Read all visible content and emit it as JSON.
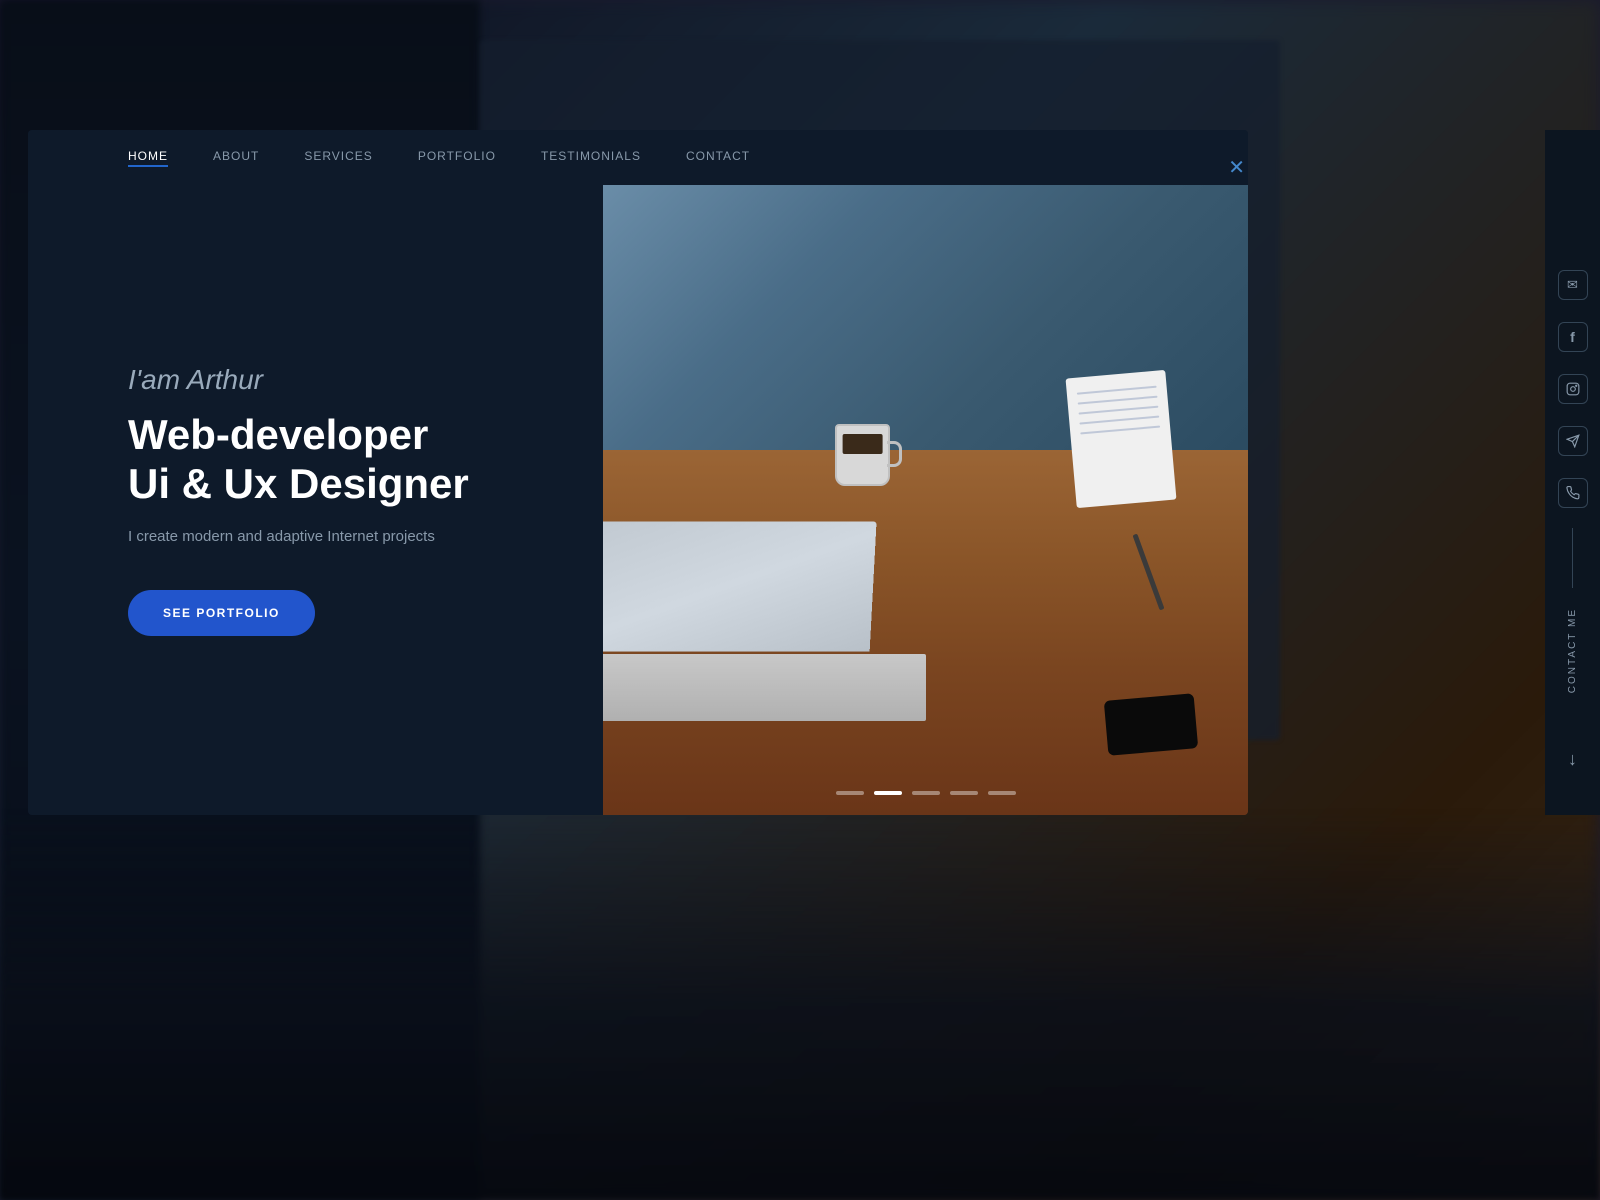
{
  "background": {
    "color": "#0a0e18"
  },
  "navbar": {
    "items": [
      {
        "label": "HOME",
        "active": true
      },
      {
        "label": "ABOUT",
        "active": false
      },
      {
        "label": "SERVICES",
        "active": false
      },
      {
        "label": "PORTFOLIO",
        "active": false
      },
      {
        "label": "TESTIMONIALS",
        "active": false
      },
      {
        "label": "CONTACT",
        "active": false
      }
    ],
    "close_label": "✕"
  },
  "hero": {
    "greeting": "I'am Arthur",
    "title_line1": "Web-developer",
    "title_line2": "Ui & Ux Designer",
    "subtitle": "I create modern and adaptive Internet projects",
    "cta_button": "SEE PORTFOLIO"
  },
  "slider": {
    "dots": [
      {
        "active": false
      },
      {
        "active": true
      },
      {
        "active": false
      },
      {
        "active": false
      },
      {
        "active": false
      }
    ]
  },
  "sidebar": {
    "social_icons": [
      {
        "name": "email-icon",
        "symbol": "✉"
      },
      {
        "name": "facebook-icon",
        "symbol": "f"
      },
      {
        "name": "instagram-icon",
        "symbol": "◯"
      },
      {
        "name": "telegram-icon",
        "symbol": "➤"
      },
      {
        "name": "whatsapp-icon",
        "symbol": "☎"
      }
    ],
    "contact_me": "Contact Me",
    "scroll_arrow": "↓"
  }
}
